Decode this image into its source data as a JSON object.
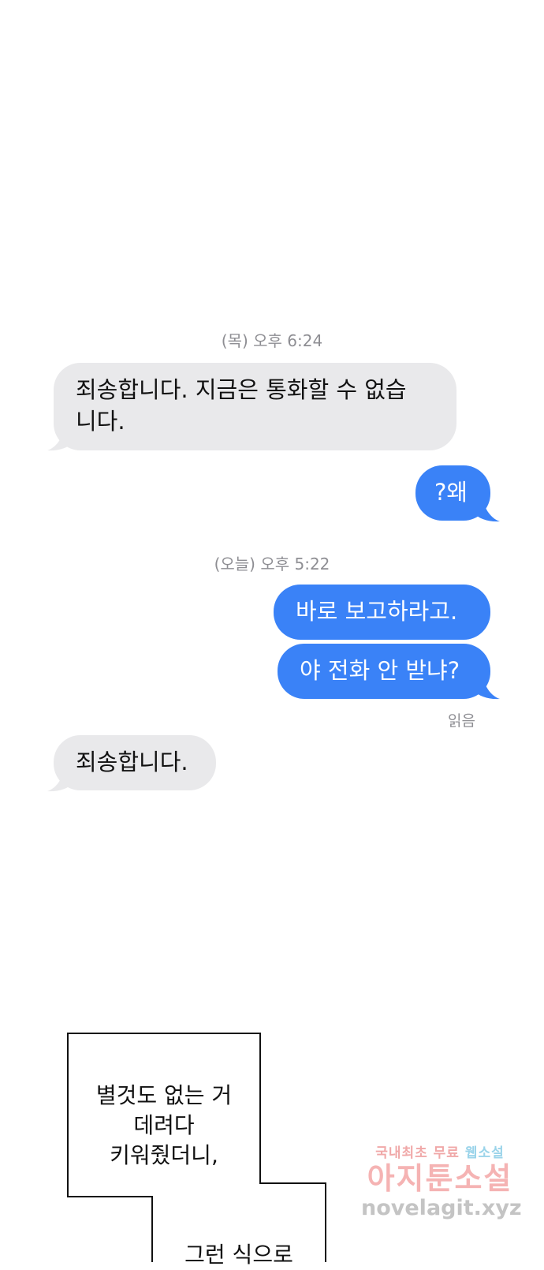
{
  "conversation": {
    "timestamp_1": "(목) 오후 6:24",
    "msg_1_line_1": "죄송합니다. 지금은 통화할 수 없습",
    "msg_1_line_2": "니다.",
    "msg_2": "?왜",
    "timestamp_2": "(오늘) 오후 5:22",
    "msg_3": "바로 보고하라고.",
    "msg_4": "야 전화 안 받냐?",
    "read_receipt": "읽음",
    "msg_5": "죄송합니다."
  },
  "colors": {
    "incoming_bubble": "#e9e9eb",
    "outgoing_bubble": "#3a82f7",
    "timestamp_text": "#8e8e93"
  },
  "caption": {
    "line_1": "별것도 없는 거",
    "line_2": "데려다",
    "line_3": "키워줬더니,",
    "line_4": "그런 식으로"
  },
  "watermark": {
    "tagline_a": "국내최초 무료",
    "tagline_b": "웹소설",
    "brand": "아지툰소설",
    "url": "novelagit.xyz"
  }
}
